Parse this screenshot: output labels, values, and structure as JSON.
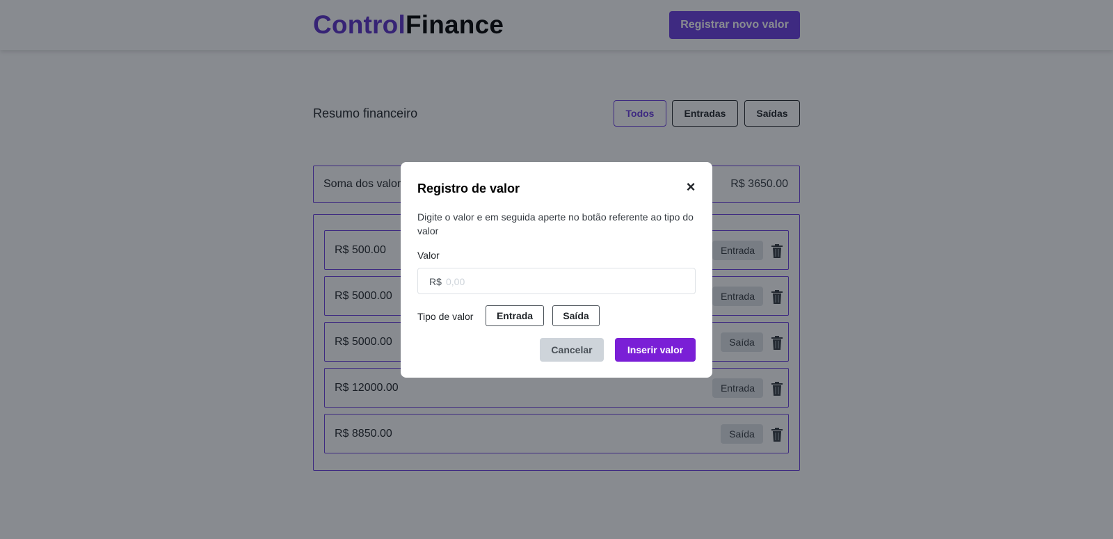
{
  "header": {
    "logo_part1": "Control",
    "logo_part2": "Finance",
    "new_value_button": "Registrar novo valor"
  },
  "summary": {
    "title": "Resumo financeiro",
    "filters": [
      "Todos",
      "Entradas",
      "Saídas"
    ],
    "active_filter": "Todos",
    "sum_label": "Soma dos valores",
    "sum_value": "R$ 3650.00"
  },
  "transactions": [
    {
      "amount": "R$ 500.00",
      "type": "Entrada"
    },
    {
      "amount": "R$ 5000.00",
      "type": "Entrada"
    },
    {
      "amount": "R$ 5000.00",
      "type": "Saída"
    },
    {
      "amount": "R$ 12000.00",
      "type": "Entrada"
    },
    {
      "amount": "R$ 8850.00",
      "type": "Saída"
    }
  ],
  "modal": {
    "title": "Registro de valor",
    "close_glyph": "×",
    "description": "Digite o valor e em seguida aperte no botão referente ao tipo do valor",
    "value_label": "Valor",
    "currency_prefix": "R$",
    "value_placeholder": "0,00",
    "value_current": "",
    "type_label": "Tipo de valor",
    "type_entrada": "Entrada",
    "type_saida": "Saída",
    "cancel_button": "Cancelar",
    "insert_button": "Inserir valor"
  },
  "colors": {
    "primary": "#6a3de0",
    "insert_button": "#7a1fd6",
    "overlay": "rgba(18,24,33,0.5)"
  },
  "icons": {
    "delete": "trash-icon",
    "close": "close-icon"
  }
}
